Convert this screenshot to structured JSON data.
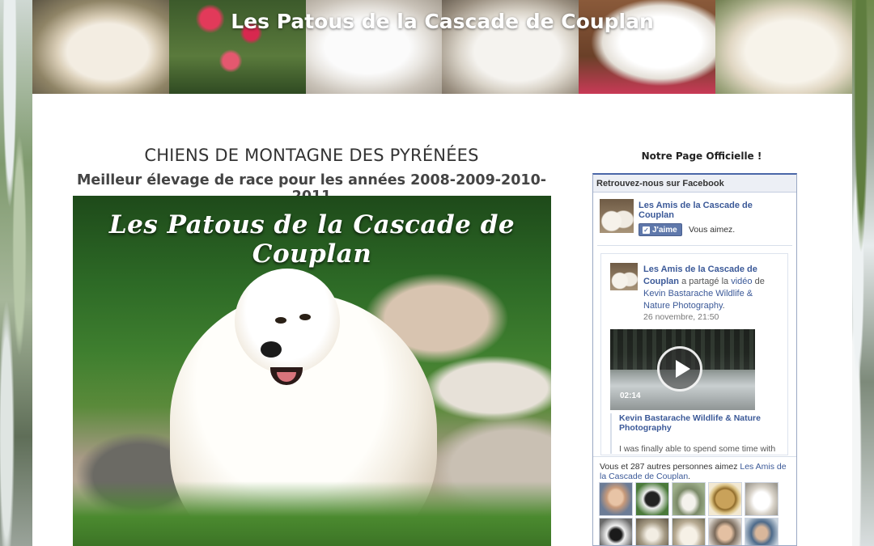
{
  "banner": {
    "title": "Les Patous de la Cascade de Couplan"
  },
  "main": {
    "heading": "CHIENS DE MONTAGNE DES PYRÉNÉES",
    "subheading": "Meilleur élevage de race pour les années 2008-2009-2010-2011",
    "hero_overlay_title": "Les Patous de la Cascade de Couplan"
  },
  "sidebar": {
    "heading": "Notre Page Officielle !",
    "facebook": {
      "box_title": "Retrouvez-nous sur Facebook",
      "page_name": "Les Amis de la Cascade de Couplan",
      "like_label": "J'aime",
      "like_status": "Vous aimez.",
      "post": {
        "author": "Les Amis de la Cascade de Couplan",
        "shared_text": "a partagé la",
        "shared_object": "vidéo",
        "of_text": "de",
        "shared_from": "Kevin Bastarache Wildlife & Nature Photography",
        "date": "26 novembre, 21:50",
        "video_duration": "02:14",
        "quote_title": "Kevin Bastarache Wildlife & Nature Photography",
        "quote_text": "I was finally able to spend some time with"
      },
      "social_text": "Vous et 287 autres personnes aimez",
      "social_page_link": "Les Amis de la Cascade de Couplan"
    }
  },
  "colors": {
    "facebook_link": "#3b5998",
    "like_button": "#5f78ab",
    "content_bg": "#ffffff"
  }
}
